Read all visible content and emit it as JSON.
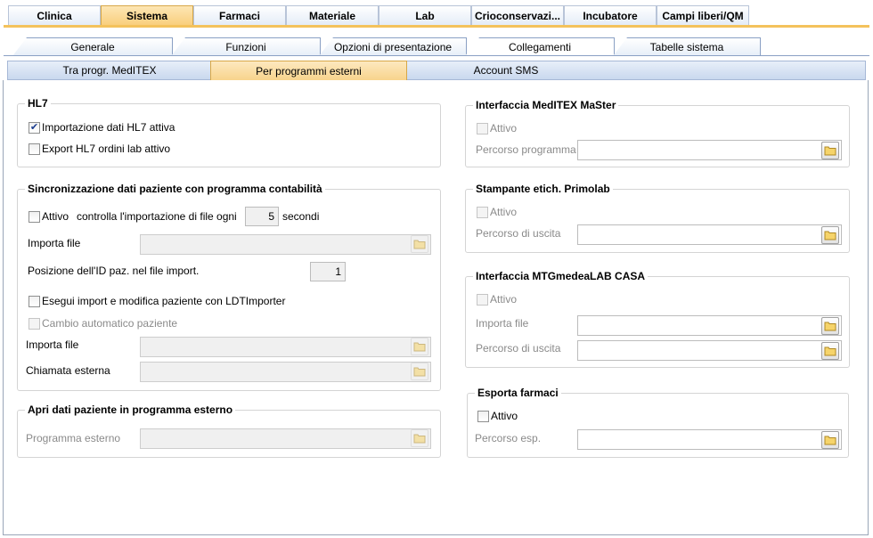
{
  "top_tabs": [
    {
      "label": "Clinica",
      "active": false
    },
    {
      "label": "Sistema",
      "active": true
    },
    {
      "label": "Farmaci",
      "active": false
    },
    {
      "label": "Materiale",
      "active": false
    },
    {
      "label": "Lab",
      "active": false
    },
    {
      "label": "Crioconservazi...",
      "active": false
    },
    {
      "label": "Incubatore",
      "active": false
    },
    {
      "label": "Campi liberi/QM",
      "active": false
    }
  ],
  "sub_tabs": [
    {
      "label": "Generale",
      "active": false
    },
    {
      "label": "Funzioni",
      "active": false
    },
    {
      "label": "Opzioni di presentazione",
      "active": false
    },
    {
      "label": "Collegamenti",
      "active": true
    },
    {
      "label": "Tabelle sistema",
      "active": false
    }
  ],
  "third_tabs": [
    {
      "label": "Tra progr. MedITEX",
      "active": false
    },
    {
      "label": "Per programmi esterni",
      "active": true
    },
    {
      "label": "Account SMS",
      "active": false
    }
  ],
  "hl7": {
    "title": "HL7",
    "import_active": {
      "label": "Importazione dati HL7 attiva",
      "checked": true
    },
    "export_active": {
      "label": "Export HL7 ordini lab attivo",
      "checked": false
    }
  },
  "sync": {
    "title": "Sincronizzazione dati paziente con programma contabilità",
    "active": {
      "label": "Attivo",
      "checked": false
    },
    "check_text": "controlla l'importazione di file ogni",
    "seconds_value": "5",
    "seconds_label": "secondi",
    "import_file_label": "Importa file",
    "import_file_value": "",
    "id_position_label": "Posizione dell'ID paz. nel file import.",
    "id_position_value": "1",
    "ldt_importer": {
      "label": "Esegui import e modifica paziente con LDTImporter",
      "checked": false
    },
    "auto_change": {
      "label": "Cambio automatico paziente",
      "checked": false
    },
    "import_file2_label": "Importa file",
    "import_file2_value": "",
    "external_call_label": "Chiamata esterna",
    "external_call_value": ""
  },
  "open_external": {
    "title": "Apri dati paziente in programma esterno",
    "program_label": "Programma esterno",
    "program_value": ""
  },
  "meditex_master": {
    "title": "Interfaccia MedITEX MaSter",
    "active": {
      "label": "Attivo",
      "checked": false
    },
    "path_label": "Percorso programma",
    "path_value": ""
  },
  "primolab": {
    "title": "Stampante etich. Primolab",
    "active": {
      "label": "Attivo",
      "checked": false
    },
    "output_label": "Percorso di uscita",
    "output_value": ""
  },
  "mtg": {
    "title": "Interfaccia  MTGmedeaLAB CASA",
    "active": {
      "label": "Attivo",
      "checked": false
    },
    "import_label": "Importa file",
    "import_value": "",
    "output_label": "Percorso di uscita",
    "output_value": ""
  },
  "export_drugs": {
    "title": "Esporta farmaci",
    "active": {
      "label": "Attivo",
      "checked": false
    },
    "path_label": "Percorso esp.",
    "path_value": ""
  },
  "colors": {
    "active_tab": "#f9cf7d",
    "tab_line": "#f4c25c",
    "accent_blue": "#c9d8ee"
  }
}
